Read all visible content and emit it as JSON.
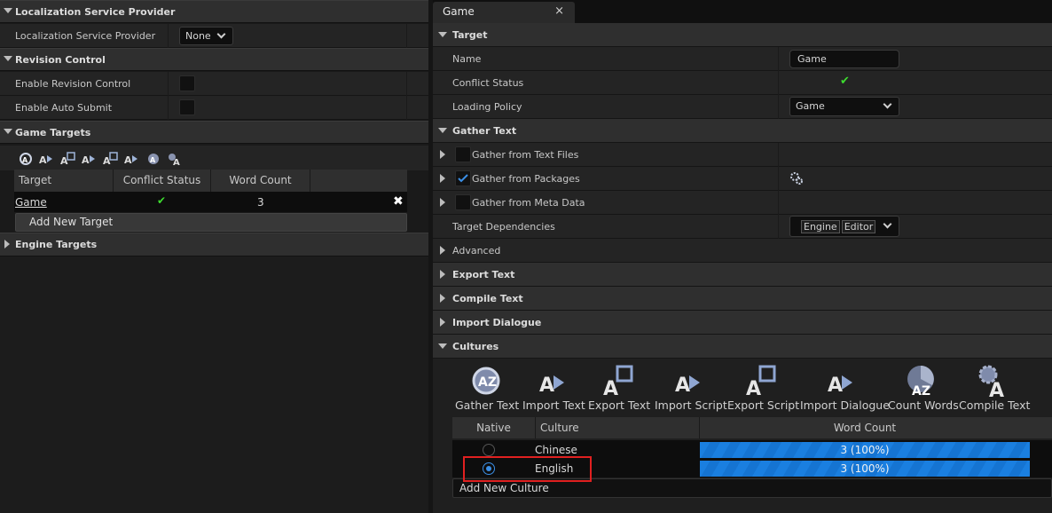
{
  "left": {
    "loc_section": {
      "title": "Localization Service Provider"
    },
    "loc_row": {
      "label": "Localization Service Provider",
      "value": "None"
    },
    "rev_section": {
      "title": "Revision Control"
    },
    "rev_rows": [
      {
        "label": "Enable Revision Control"
      },
      {
        "label": "Enable Auto Submit"
      }
    ],
    "targets_section": {
      "title": "Game Targets"
    },
    "targets_table": {
      "headers": [
        "Target",
        "Conflict Status",
        "Word Count"
      ],
      "row": {
        "target": "Game",
        "status": "✔",
        "count": "3",
        "delete": "✖"
      }
    },
    "add_target": "Add New Target",
    "engine_section": {
      "title": "Engine Targets"
    }
  },
  "right": {
    "tab": {
      "label": "Game",
      "close": "×"
    },
    "target_section": {
      "title": "Target"
    },
    "name_row": {
      "label": "Name",
      "value": "Game"
    },
    "conflict_row": {
      "label": "Conflict Status",
      "icon": "✔"
    },
    "policy_row": {
      "label": "Loading Policy",
      "value": "Game"
    },
    "gather_section": {
      "title": "Gather Text"
    },
    "gather_rows": [
      {
        "label": "Gather from Text Files",
        "checked": false
      },
      {
        "label": "Gather from Packages",
        "checked": true
      },
      {
        "label": "Gather from Meta Data",
        "checked": false
      }
    ],
    "deps_row": {
      "label": "Target Dependencies",
      "tags": [
        "Engine",
        "Editor"
      ]
    },
    "advanced_row": {
      "label": "Advanced"
    },
    "collapsed_sections": [
      "Export Text",
      "Compile Text",
      "Import Dialogue"
    ],
    "cultures_section": {
      "title": "Cultures"
    },
    "tools": [
      "Gather Text",
      "Import Text",
      "Export Text",
      "Import Script",
      "Export Script",
      "Import Dialogue",
      "Count Words",
      "Compile Text"
    ],
    "culture_table": {
      "headers": [
        "Native",
        "Culture",
        "Word Count"
      ],
      "rows": [
        {
          "culture": "Chinese",
          "native": false,
          "progress": "3 (100%)",
          "fraction": 1.0
        },
        {
          "culture": "English",
          "native": true,
          "progress": "3 (100%)",
          "fraction": 1.0
        }
      ]
    },
    "add_culture": "Add New Culture"
  },
  "colors": {
    "accent": "#1a7fe0",
    "check": "#3ddc2f",
    "highlight": "#e02020"
  }
}
